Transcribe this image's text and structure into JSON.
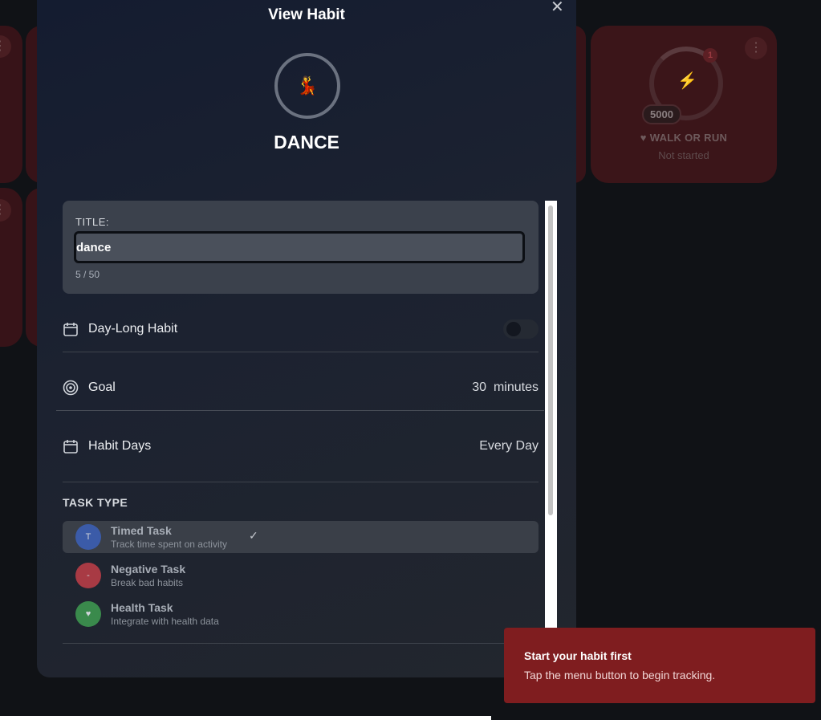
{
  "modal": {
    "title": "View Habit",
    "close_icon": "close-icon",
    "avatar_emoji": "💃",
    "habit_name": "DANCE",
    "title_field": {
      "label": "TITLE:",
      "value": "dance",
      "char_count": "5 / 50"
    },
    "day_long": {
      "label": "Day-Long Habit",
      "icon": "calendar-icon",
      "enabled": false
    },
    "goal": {
      "label": "Goal",
      "icon": "target-icon",
      "value": "30",
      "unit": "minutes"
    },
    "habit_days": {
      "label": "Habit Days",
      "icon": "calendar-icon",
      "value": "Every Day"
    },
    "task_type": {
      "header": "TASK TYPE",
      "options": [
        {
          "initial": "T",
          "name": "Timed Task",
          "desc": "Track time spent on activity",
          "selected": true,
          "color": "#3b5ba8"
        },
        {
          "initial": "-",
          "name": "Negative Task",
          "desc": "Break bad habits",
          "selected": false,
          "color": "#a83a44"
        },
        {
          "initial": "♥",
          "name": "Health Task",
          "desc": "Integrate with health data",
          "selected": false,
          "color": "#3a8a4c"
        }
      ]
    }
  },
  "background_card": {
    "badge": "1",
    "goal": "5000",
    "title": "WALK OR RUN",
    "status": "Not started"
  },
  "toast": {
    "title": "Start your habit first",
    "message": "Tap the menu button to begin tracking."
  }
}
